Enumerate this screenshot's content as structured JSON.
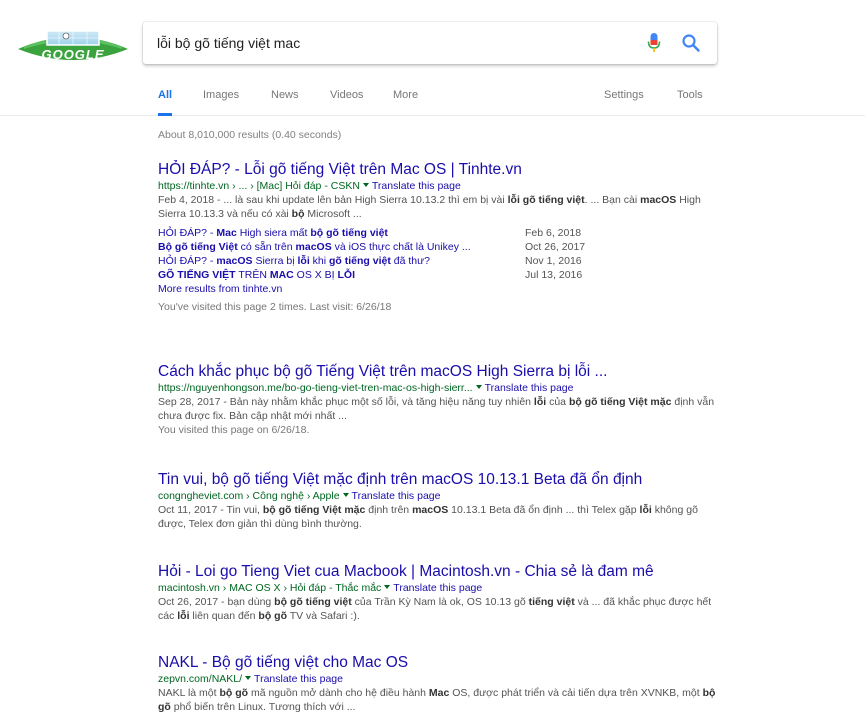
{
  "search": {
    "query": "lỗi bộ gõ tiếng việt mac"
  },
  "tabs": [
    {
      "label": "All",
      "active": true
    },
    {
      "label": "Images",
      "active": false
    },
    {
      "label": "News",
      "active": false
    },
    {
      "label": "Videos",
      "active": false
    },
    {
      "label": "More",
      "active": false
    },
    {
      "label": "Settings",
      "active": false
    },
    {
      "label": "Tools",
      "active": false
    }
  ],
  "stats": "About 8,010,000 results (0.40 seconds)",
  "translate_label": "Translate this page",
  "colors": {
    "link": "#1a0dab",
    "url": "#006621",
    "accent": "#1a73e8",
    "mic_red": "#ea4335",
    "mic_blue": "#4285f4"
  },
  "icons": [
    "google-doodle-logo",
    "microphone-icon",
    "search-icon",
    "caret-down-icon"
  ],
  "results": [
    {
      "title": "HỎI ĐÁP? - Lỗi gõ tiếng Việt trên Mac OS | Tinhte.vn",
      "url": "https://tinhte.vn › ... › [Mac] Hỏi đáp - CSKN",
      "snippet_html": "Feb 4, 2018 - ... là sau khi update lên bản High Sierra 10.13.2 thì em bị vài <b>lỗi gõ tiếng việt</b>. ... Bạn cài <b>macOS</b> High Sierra 10.13.3 và nếu có xài <b>bộ</b> Microsoft ...",
      "sublinks": [
        {
          "text_html": "HỎI ĐÁP? - <b>Mac</b> High siera mất <b>bộ gõ tiếng việt</b>",
          "date": "Feb 6, 2018"
        },
        {
          "text_html": "<b>Bộ gõ tiếng Việt</b> có sẵn trên <b>macOS</b> và iOS thực chất là Unikey ...",
          "date": "Oct 26, 2017"
        },
        {
          "text_html": "HỎI ĐÁP? - <b>macOS</b> Sierra bị <b>lỗi</b> khi <b>gõ tiếng việt</b> đã thư?",
          "date": "Nov 1, 2016"
        },
        {
          "text_html": "<b>GÕ TIẾNG VIỆT</b> TRÊN <b>MAC</b> OS X BỊ <b>LỖI</b>",
          "date": "Jul 13, 2016"
        }
      ],
      "more": "More results from tinhte.vn",
      "visited": "You've visited this page 2 times. Last visit: 6/26/18"
    },
    {
      "title": "Cách khắc phục bộ gõ Tiếng Việt trên macOS High Sierra bị lỗi ...",
      "url": "https://nguyenhongson.me/bo-go-tieng-viet-tren-mac-os-high-sierr...",
      "snippet_html": "Sep 28, 2017 - Bản này nhằm khắc phục một số lỗi, và tăng hiệu năng tuy nhiên <b>lỗi</b> của <b>bộ gõ tiếng Việt mặc</b> định vẫn chưa được fix. Bản cập nhật mới nhất ...",
      "visited": "You visited this page on 6/26/18."
    },
    {
      "title": "Tin vui, bộ gõ tiếng Việt mặc định trên macOS 10.13.1 Beta đã ổn định",
      "url": "congngheviet.com › Công nghệ › Apple",
      "snippet_html": "Oct 11, 2017 - Tin vui, <b>bộ gõ tiếng Việt mặc</b> định trên <b>macOS</b> 10.13.1 Beta đã ổn định ... thì Telex gặp <b>lỗi</b> không gõ được, Telex đơn giản thì dùng bình thường."
    },
    {
      "title": "Hỏi - Loi go Tieng Viet cua Macbook | Macintosh.vn - Chia sẻ là đam mê",
      "url": "macintosh.vn › MAC OS X › Hỏi đáp - Thắc mắc",
      "snippet_html": "Oct 26, 2017 - bạn dùng <b>bộ gõ tiếng việt</b> của Trần Kỳ Nam là ok, OS 10.13 gõ <b>tiếng việt</b> và ... đã khắc phục được hết các <b>lỗi</b> liên quan đến <b>bộ gõ</b> TV và Safari :)."
    },
    {
      "title": "NAKL - Bộ gõ tiếng việt cho Mac OS",
      "url": "zepvn.com/NAKL/",
      "snippet_html": "NAKL là một <b>bộ gõ</b> mã nguồn mở dành cho hệ điều hành <b>Mac</b> OS, được phát triển và cải tiến dựa trên XVNKB, một <b>bộ gõ</b> phổ biến trên Linux. Tương thích với ..."
    }
  ]
}
